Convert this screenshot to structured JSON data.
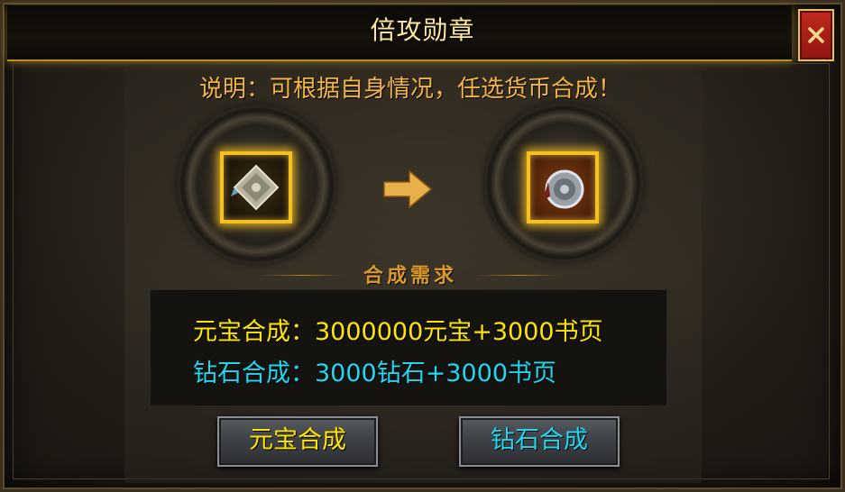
{
  "window": {
    "title": "倍攻勋章"
  },
  "description": "说明：可根据自身情况，任选货币合成！",
  "icons": {
    "close": "close-icon",
    "source_item": "medal-fragment-icon",
    "result_item": "medal-icon",
    "arrow": "arrow-right-icon"
  },
  "requirements": {
    "heading": "合成需求",
    "yuanbao_line": "元宝合成：3000000元宝+3000书页",
    "zuanshi_line": "钻石合成：3000钻石+3000书页"
  },
  "buttons": {
    "yuanbao_label": "元宝合成",
    "zuanshi_label": "钻石合成"
  },
  "colors": {
    "title": "#ffe89a",
    "description": "#f3b545",
    "yuanbao": "#ffe600",
    "zuanshi": "#1fd8f0",
    "frame_gold": "#f5c020",
    "close_red": "#c22a20"
  }
}
